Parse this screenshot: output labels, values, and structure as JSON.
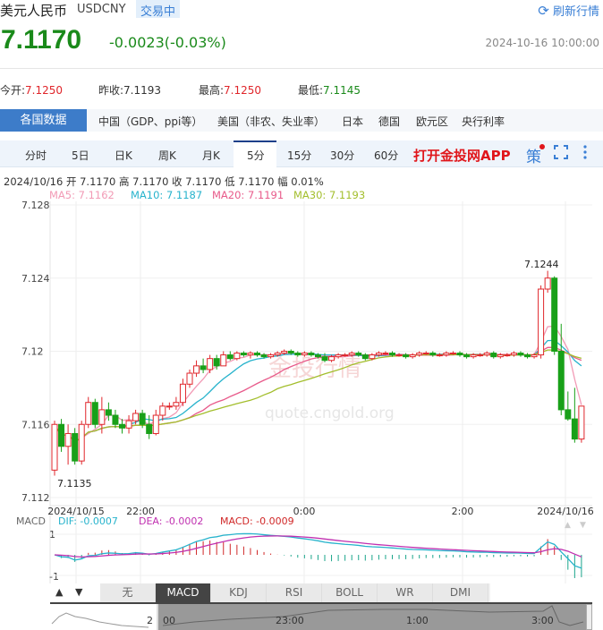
{
  "header": {
    "title": "美元人民币",
    "symbol": "USDCNY",
    "status": "交易中",
    "refresh": "刷新行情",
    "price": "7.1170",
    "change": "-0.0023(-0.03%)",
    "timestamp": "2024-10-16 10:00:00"
  },
  "stats": [
    {
      "label": "今开:",
      "value": "7.1250",
      "color": "red"
    },
    {
      "label": "昨收:",
      "value": "7.1193",
      "color": "normal"
    },
    {
      "label": "最高:",
      "value": "7.1250",
      "color": "red"
    },
    {
      "label": "最低:",
      "value": "7.1145",
      "color": "green"
    }
  ],
  "country_tabs": [
    "各国数据",
    "中国（GDP、ppi等）",
    "美国（非农、失业率）",
    "日本",
    "德国",
    "欧元区",
    "央行利率"
  ],
  "period_tabs": [
    "分时",
    "5日",
    "日K",
    "周K",
    "月K",
    "5分",
    "15分",
    "30分",
    "60分"
  ],
  "active_period": "5分",
  "app_link": "打开金投网APP",
  "strategy": "策",
  "info_line": "2024/10/16  开 7.1170  高 7.1170  收 7.1170  低 7.1170  幅 0.01%",
  "ma": [
    {
      "label": "MA5: 7.1162",
      "color": "#f29ab5"
    },
    {
      "label": "MA10: 7.1187",
      "color": "#27b3cc"
    },
    {
      "label": "MA20: 7.1191",
      "color": "#e85a8a"
    },
    {
      "label": "MA30: 7.1193",
      "color": "#a3be2c"
    }
  ],
  "watermark": {
    "text": "金投行情",
    "url": "quote.cngold.org"
  },
  "chart_data": {
    "type": "candlestick",
    "y_ticks": [
      "7.128",
      "7.124",
      "7.12",
      "7.116",
      "7.112"
    ],
    "ylim": [
      7.112,
      7.128
    ],
    "x_ticks": [
      "2024/10/15",
      "22:00",
      "0:00",
      "2:00",
      "2024/10/16"
    ],
    "annotations": {
      "max": "7.1244",
      "min": "7.1135"
    },
    "colors": {
      "up": "#e0262b",
      "down": "#18a018"
    },
    "candles_ohlc": [
      [
        7.1135,
        7.1162,
        7.1132,
        7.116
      ],
      [
        7.116,
        7.1163,
        7.1145,
        7.1148
      ],
      [
        7.1148,
        7.116,
        7.1138,
        7.1155
      ],
      [
        7.1155,
        7.1158,
        7.1138,
        7.114
      ],
      [
        7.114,
        7.1162,
        7.1138,
        7.116
      ],
      [
        7.116,
        7.1175,
        7.1158,
        7.1172
      ],
      [
        7.1172,
        7.1174,
        7.1158,
        7.116
      ],
      [
        7.116,
        7.1175,
        7.1155,
        7.1168
      ],
      [
        7.1168,
        7.1172,
        7.1162,
        7.1165
      ],
      [
        7.1165,
        7.1168,
        7.1158,
        7.116
      ],
      [
        7.116,
        7.1163,
        7.1155,
        7.1158
      ],
      [
        7.1158,
        7.1165,
        7.1155,
        7.1162
      ],
      [
        7.1162,
        7.1168,
        7.116,
        7.1166
      ],
      [
        7.1166,
        7.1168,
        7.1158,
        7.116
      ],
      [
        7.116,
        7.1165,
        7.1152,
        7.1155
      ],
      [
        7.1155,
        7.1168,
        7.1154,
        7.1165
      ],
      [
        7.1165,
        7.1172,
        7.1162,
        7.117
      ],
      [
        7.117,
        7.1172,
        7.1168,
        7.117
      ],
      [
        7.117,
        7.1175,
        7.1168,
        7.1172
      ],
      [
        7.1172,
        7.1185,
        7.117,
        7.1182
      ],
      [
        7.1182,
        7.119,
        7.118,
        7.1188
      ],
      [
        7.1188,
        7.1195,
        7.1186,
        7.1192
      ],
      [
        7.1192,
        7.1196,
        7.1188,
        7.119
      ],
      [
        7.119,
        7.1198,
        7.1188,
        7.1196
      ],
      [
        7.1196,
        7.1198,
        7.119,
        7.1192
      ],
      [
        7.1192,
        7.12,
        7.1192,
        7.1198
      ],
      [
        7.1198,
        7.12,
        7.1195,
        7.1196
      ],
      [
        7.1196,
        7.12,
        7.1195,
        7.1199
      ],
      [
        7.1199,
        7.12,
        7.1197,
        7.1198
      ],
      [
        7.1198,
        7.12,
        7.1196,
        7.1199
      ],
      [
        7.1199,
        7.12,
        7.1197,
        7.1198
      ],
      [
        7.1198,
        7.1199,
        7.1196,
        7.1197
      ],
      [
        7.1197,
        7.1199,
        7.1196,
        7.1198
      ],
      [
        7.1198,
        7.12,
        7.1197,
        7.1199
      ],
      [
        7.1199,
        7.1201,
        7.1198,
        7.12
      ],
      [
        7.12,
        7.1201,
        7.1198,
        7.1199
      ],
      [
        7.1199,
        7.12,
        7.1197,
        7.1198
      ],
      [
        7.1198,
        7.12,
        7.1197,
        7.1199
      ],
      [
        7.1199,
        7.12,
        7.1197,
        7.1198
      ],
      [
        7.1198,
        7.1199,
        7.1196,
        7.1197
      ],
      [
        7.1197,
        7.1199,
        7.1194,
        7.1195
      ],
      [
        7.1195,
        7.1198,
        7.1194,
        7.1197
      ],
      [
        7.1197,
        7.1199,
        7.1196,
        7.1198
      ],
      [
        7.1198,
        7.1199,
        7.1197,
        7.1198
      ],
      [
        7.1198,
        7.12,
        7.1197,
        7.1199
      ],
      [
        7.1199,
        7.12,
        7.1197,
        7.1198
      ],
      [
        7.1198,
        7.1199,
        7.1195,
        7.1196
      ],
      [
        7.1196,
        7.1199,
        7.1195,
        7.1198
      ],
      [
        7.1198,
        7.12,
        7.1197,
        7.1199
      ],
      [
        7.1199,
        7.12,
        7.1198,
        7.1199
      ],
      [
        7.1199,
        7.12,
        7.1197,
        7.1198
      ],
      [
        7.1198,
        7.1199,
        7.1197,
        7.1198
      ],
      [
        7.1198,
        7.1199,
        7.1196,
        7.1197
      ],
      [
        7.1197,
        7.1199,
        7.1196,
        7.1198
      ],
      [
        7.1198,
        7.12,
        7.1197,
        7.1199
      ],
      [
        7.1199,
        7.12,
        7.1198,
        7.1199
      ],
      [
        7.1199,
        7.12,
        7.1197,
        7.1198
      ],
      [
        7.1198,
        7.1199,
        7.1197,
        7.1198
      ],
      [
        7.1198,
        7.12,
        7.1197,
        7.1199
      ],
      [
        7.1199,
        7.12,
        7.1198,
        7.1199
      ],
      [
        7.1199,
        7.12,
        7.1197,
        7.1198
      ],
      [
        7.1198,
        7.1199,
        7.1196,
        7.1197
      ],
      [
        7.1197,
        7.1199,
        7.1196,
        7.1198
      ],
      [
        7.1198,
        7.1199,
        7.1197,
        7.1198
      ],
      [
        7.1198,
        7.12,
        7.1197,
        7.1199
      ],
      [
        7.1199,
        7.12,
        7.1196,
        7.1197
      ],
      [
        7.1197,
        7.1199,
        7.1196,
        7.1198
      ],
      [
        7.1198,
        7.1199,
        7.1197,
        7.1198
      ],
      [
        7.1198,
        7.12,
        7.1197,
        7.1199
      ],
      [
        7.1199,
        7.12,
        7.1197,
        7.1198
      ],
      [
        7.1198,
        7.1199,
        7.1196,
        7.1197
      ],
      [
        7.1197,
        7.1199,
        7.1196,
        7.1198
      ],
      [
        7.1198,
        7.1236,
        7.1196,
        7.1234
      ],
      [
        7.1234,
        7.1244,
        7.1232,
        7.124
      ],
      [
        7.124,
        7.1241,
        7.1198,
        7.12
      ],
      [
        7.12,
        7.1215,
        7.1165,
        7.1168
      ],
      [
        7.1168,
        7.1178,
        7.1162,
        7.1163
      ],
      [
        7.1163,
        7.118,
        7.115,
        7.1152
      ],
      [
        7.1152,
        7.117,
        7.115,
        7.117
      ]
    ]
  },
  "macd": {
    "label": "MACD",
    "dif": "DIF: -0.0007",
    "dea": "DEA: -0.0002",
    "macd": "MACD: -0.0009",
    "y_ticks": [
      "1",
      "-1"
    ],
    "dif_color": "#27b3cc",
    "dea_color": "#c030b0",
    "macd_color": "#d02828"
  },
  "indicator_tabs": [
    "无",
    "MACD",
    "KDJ",
    "RSI",
    "BOLL",
    "WR",
    "DMI"
  ],
  "active_indicator": "MACD",
  "navigator": {
    "labels": [
      "2",
      "00",
      "23:00",
      "1:00",
      "3:00"
    ]
  }
}
